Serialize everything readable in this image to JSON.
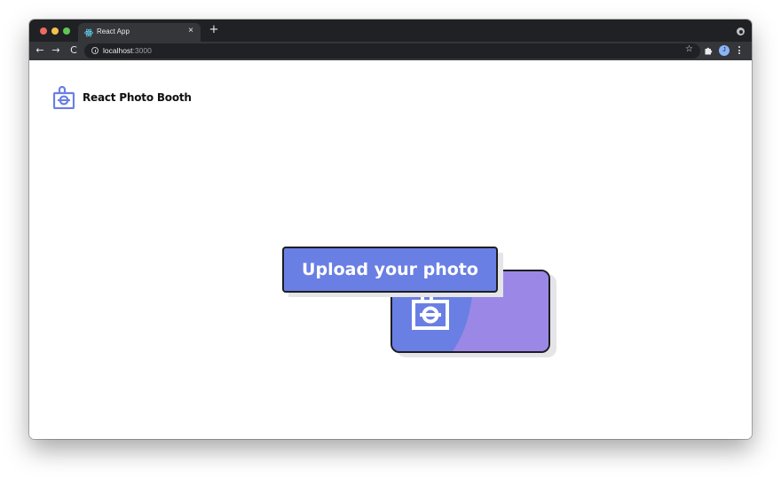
{
  "browser": {
    "tab": {
      "title": "React App",
      "close_glyph": "×"
    },
    "new_tab_glyph": "+",
    "nav": {
      "back_glyph": "←",
      "forward_glyph": "→",
      "reload_glyph": "C"
    },
    "address": {
      "host": "localhost",
      "port": ":3000"
    },
    "bookmark_glyph": "☆",
    "profile_initial": "J",
    "icons": [
      "react-favicon",
      "info-icon",
      "star-icon",
      "puzzle-extension-icon",
      "kebab-menu-icon",
      "window-menu-icon"
    ]
  },
  "app": {
    "title": "React Photo Booth",
    "upload_button_label": "Upload your photo",
    "logo_icon": "camera-lock-icon",
    "colors": {
      "accent": "#6a7fe3",
      "accent_light": "#9b88e6",
      "outline": "#1e1e22",
      "shadow": "#e5e5e8"
    }
  },
  "window_chrome": {
    "colors": {
      "tabbar": "#202124",
      "toolbar": "#35363a",
      "red": "#ed6a5e",
      "yellow": "#f5bf4f",
      "green": "#62c554"
    }
  }
}
